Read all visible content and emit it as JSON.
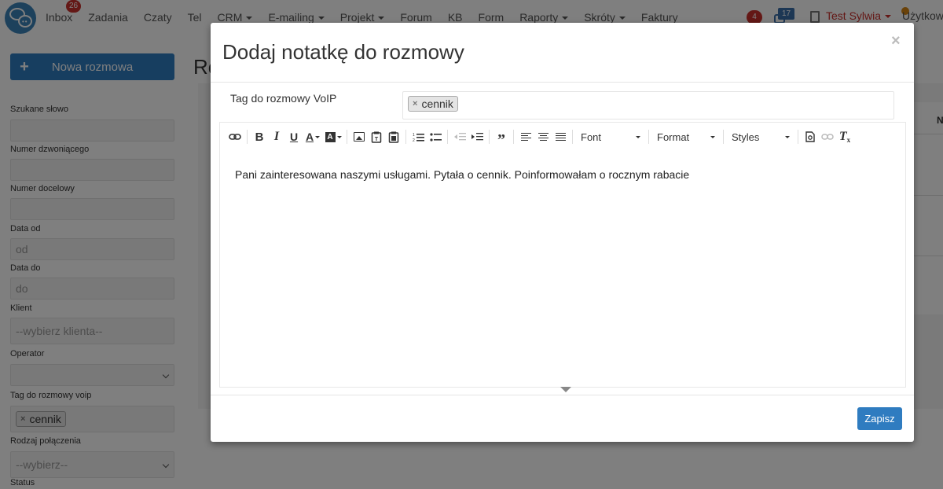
{
  "nav": {
    "menu": [
      {
        "label": "Inbox",
        "badge": "26",
        "dropdown": false
      },
      {
        "label": "Zadania",
        "dropdown": false
      },
      {
        "label": "Czaty",
        "dropdown": false
      },
      {
        "label": "Tel",
        "dropdown": false
      },
      {
        "label": "CRM",
        "dropdown": true
      },
      {
        "label": "E-mailing",
        "dropdown": true
      },
      {
        "label": "Projekt",
        "dropdown": true
      },
      {
        "label": "Forum",
        "dropdown": false
      },
      {
        "label": "KB",
        "dropdown": false
      },
      {
        "label": "Form",
        "dropdown": false
      },
      {
        "label": "Raporty",
        "dropdown": true
      },
      {
        "label": "Skróty",
        "dropdown": true
      },
      {
        "label": "Faktury",
        "dropdown": false
      }
    ],
    "notifications_count": "4",
    "messages_count": "17",
    "user_name": "Test Sylwia",
    "users_link": "Użytkownicy"
  },
  "sidebar": {
    "new_conversation_label": "Nowa rozmowa",
    "filters": {
      "search_word": {
        "label": "Szukane słowo",
        "value": ""
      },
      "caller_number": {
        "label": "Numer dzwoniącego",
        "value": ""
      },
      "target_number": {
        "label": "Numer docelowy",
        "value": ""
      },
      "date_from": {
        "label": "Data od",
        "placeholder": "od"
      },
      "date_to": {
        "label": "Data do",
        "placeholder": "do"
      },
      "client": {
        "label": "Klient",
        "placeholder": "--wybierz klienta--"
      },
      "operator": {
        "label": "Operator",
        "value": ""
      },
      "voip_tag": {
        "label": "Tag do rozmowy voip",
        "tags": [
          "cennik"
        ]
      },
      "call_type": {
        "label": "Rodzaj połączenia",
        "value": "--wybierz--"
      },
      "status": {
        "label": "Status"
      }
    }
  },
  "background": {
    "page_title": "Ro",
    "table_header_partial": "N"
  },
  "modal": {
    "title": "Dodaj notatkę do rozmowy",
    "close_symbol": "×",
    "tag_label": "Tag do rozmowy VoIP",
    "tags": [
      "cennik"
    ],
    "toolbar": {
      "font_label": "Font",
      "format_label": "Format",
      "styles_label": "Styles"
    },
    "note_text": "Pani zainteresowana naszymi usługami. Pytała o cennik. Poinformowałam o rocznym rabacie",
    "save_label": "Zapisz"
  },
  "colors": {
    "primary": "#2f7cc0",
    "badge_red": "#c9302c",
    "user_red": "#c9302c"
  }
}
